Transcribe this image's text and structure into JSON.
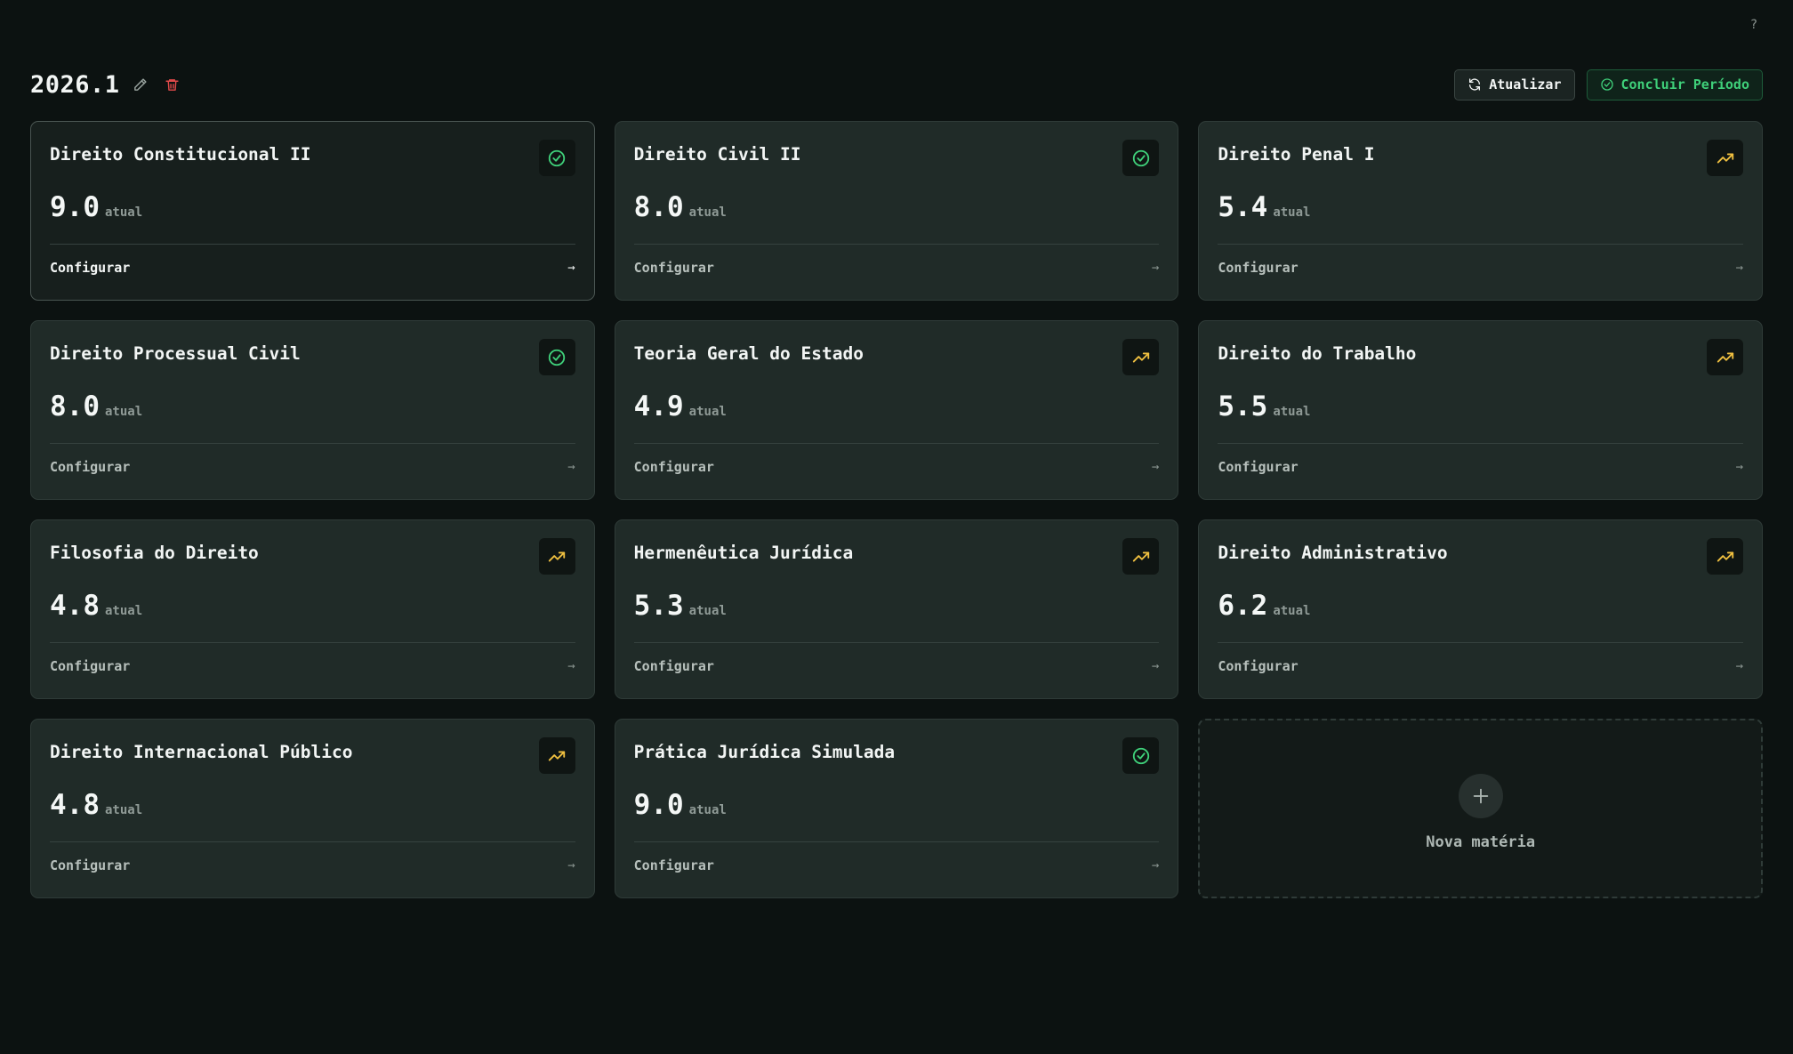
{
  "help_label": "?",
  "period": {
    "title": "2026.1",
    "icons": {
      "edit": "pencil-icon",
      "delete": "trash-icon"
    }
  },
  "actions": {
    "refresh_label": "Atualizar",
    "conclude_label": "Concluir Período"
  },
  "colors": {
    "approved": "#3fd07a",
    "trending": "#f0c040",
    "delete": "#e04a4a",
    "background": "#0c1211",
    "card": "#202b28"
  },
  "subjects": [
    {
      "name": "Direito Constitucional II",
      "grade": "9.0",
      "grade_label": "atual",
      "status": "check-circle-icon",
      "config_label": "Configurar"
    },
    {
      "name": "Direito Civil II",
      "grade": "8.0",
      "grade_label": "atual",
      "status": "check-circle-icon",
      "config_label": "Configurar"
    },
    {
      "name": "Direito Penal I",
      "grade": "5.4",
      "grade_label": "atual",
      "status": "trending-up-icon",
      "config_label": "Configurar"
    },
    {
      "name": "Direito Processual Civil",
      "grade": "8.0",
      "grade_label": "atual",
      "status": "check-circle-icon",
      "config_label": "Configurar"
    },
    {
      "name": "Teoria Geral do Estado",
      "grade": "4.9",
      "grade_label": "atual",
      "status": "trending-up-icon",
      "config_label": "Configurar"
    },
    {
      "name": "Direito do Trabalho",
      "grade": "5.5",
      "grade_label": "atual",
      "status": "trending-up-icon",
      "config_label": "Configurar"
    },
    {
      "name": "Filosofia do Direito",
      "grade": "4.8",
      "grade_label": "atual",
      "status": "trending-up-icon",
      "config_label": "Configurar"
    },
    {
      "name": "Hermenêutica Jurídica",
      "grade": "5.3",
      "grade_label": "atual",
      "status": "trending-up-icon",
      "config_label": "Configurar"
    },
    {
      "name": "Direito Administrativo",
      "grade": "6.2",
      "grade_label": "atual",
      "status": "trending-up-icon",
      "config_label": "Configurar"
    },
    {
      "name": "Direito Internacional Público",
      "grade": "4.8",
      "grade_label": "atual",
      "status": "trending-up-icon",
      "config_label": "Configurar"
    },
    {
      "name": "Prática Jurídica Simulada",
      "grade": "9.0",
      "grade_label": "atual",
      "status": "check-circle-icon",
      "config_label": "Configurar"
    }
  ],
  "new_subject_label": "Nova matéria"
}
